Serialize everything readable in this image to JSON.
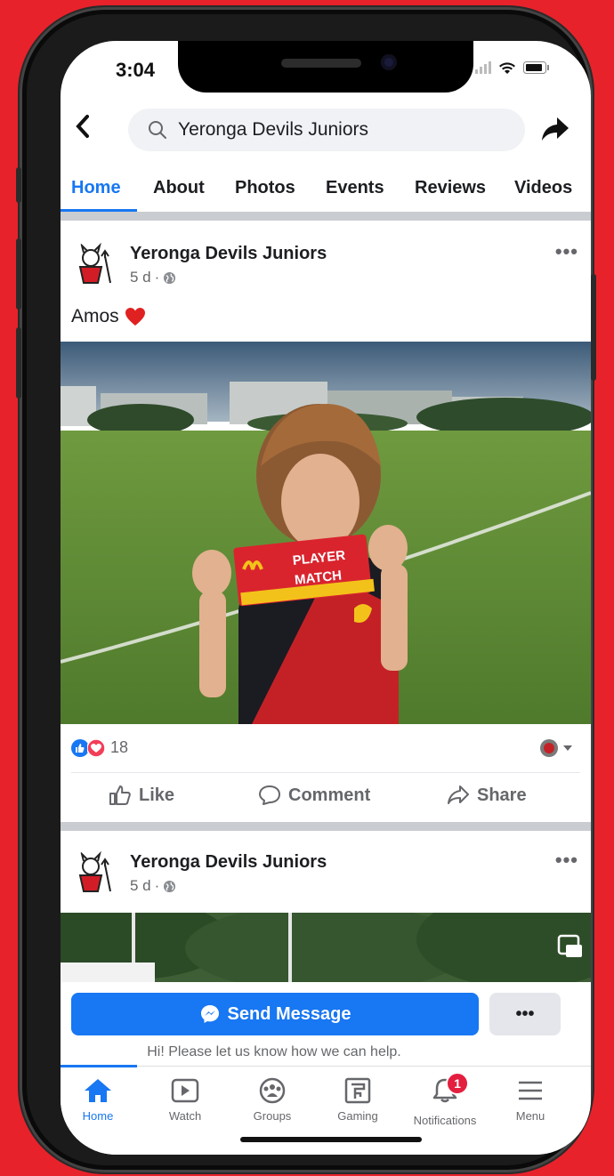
{
  "status": {
    "time": "3:04"
  },
  "search": {
    "query": "Yeronga Devils Juniors"
  },
  "tabs": [
    {
      "label": "Home"
    },
    {
      "label": "About"
    },
    {
      "label": "Photos"
    },
    {
      "label": "Events"
    },
    {
      "label": "Reviews"
    },
    {
      "label": "Videos"
    }
  ],
  "post1": {
    "page_name": "Yeronga Devils Juniors",
    "time": "5 d",
    "caption": "Amos",
    "reaction_count": "18",
    "actions": {
      "like": "Like",
      "comment": "Comment",
      "share": "Share"
    }
  },
  "post2": {
    "page_name": "Yeronga Devils Juniors",
    "time": "5 d"
  },
  "message_bar": {
    "send_label": "Send Message",
    "more_label": "•••",
    "help_text": "Hi! Please let us know how we can help."
  },
  "bottom_nav": [
    {
      "label": "Home",
      "icon": "home-icon"
    },
    {
      "label": "Watch",
      "icon": "watch-icon"
    },
    {
      "label": "Groups",
      "icon": "groups-icon"
    },
    {
      "label": "Gaming",
      "icon": "gaming-icon"
    },
    {
      "label": "Notifications",
      "icon": "bell-icon",
      "badge": "1"
    },
    {
      "label": "Menu",
      "icon": "menu-icon"
    }
  ],
  "colors": {
    "brand_blue": "#1877f2",
    "background_red": "#e8222b",
    "badge_red": "#e41e3f"
  }
}
